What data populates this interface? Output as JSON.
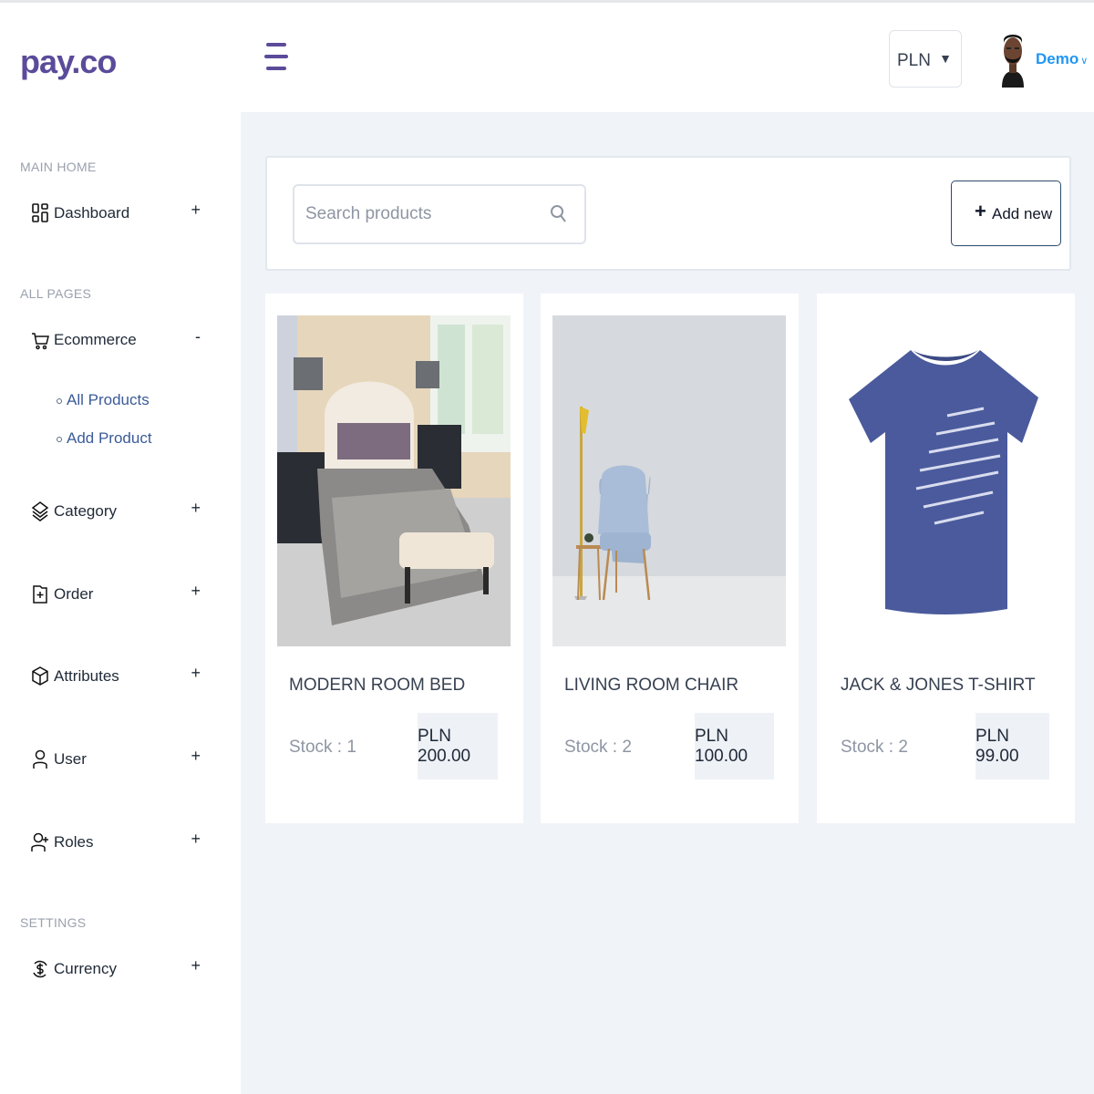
{
  "header": {
    "logo": "pay.co",
    "currency": "PLN",
    "user_name": "Demo"
  },
  "sidebar": {
    "sections": [
      {
        "title": "MAIN HOME"
      },
      {
        "title": "ALL PAGES"
      },
      {
        "title": "SETTINGS"
      }
    ],
    "items": [
      {
        "label": "Dashboard",
        "icon": "dashboard-icon",
        "toggle": "+"
      },
      {
        "label": "Ecommerce",
        "icon": "cart-icon",
        "toggle": "-"
      },
      {
        "label": "Category",
        "icon": "layers-icon",
        "toggle": "+"
      },
      {
        "label": "Order",
        "icon": "file-plus-icon",
        "toggle": "+"
      },
      {
        "label": "Attributes",
        "icon": "box-icon",
        "toggle": "+"
      },
      {
        "label": "User",
        "icon": "user-icon",
        "toggle": "+"
      },
      {
        "label": "Roles",
        "icon": "user-plus-icon",
        "toggle": "+"
      },
      {
        "label": "Currency",
        "icon": "currency-icon",
        "toggle": "+"
      }
    ],
    "ecommerce_sub": [
      {
        "label": "All Products"
      },
      {
        "label": "Add Product"
      }
    ]
  },
  "toolbar": {
    "search_placeholder": "Search products",
    "add_label": "Add new"
  },
  "products": [
    {
      "name": "MODERN ROOM BED",
      "stock": "Stock :  1",
      "price": "PLN 200.00"
    },
    {
      "name": "LIVING ROOM CHAIR",
      "stock": "Stock :  2",
      "price": "PLN 100.00"
    },
    {
      "name": "JACK & JONES T-SHIRT",
      "stock": "Stock :  2",
      "price": "PLN 99.00"
    }
  ],
  "colors": {
    "brand": "#5b4b9a",
    "link": "#2196f3",
    "main_bg": "#f0f3f8"
  }
}
